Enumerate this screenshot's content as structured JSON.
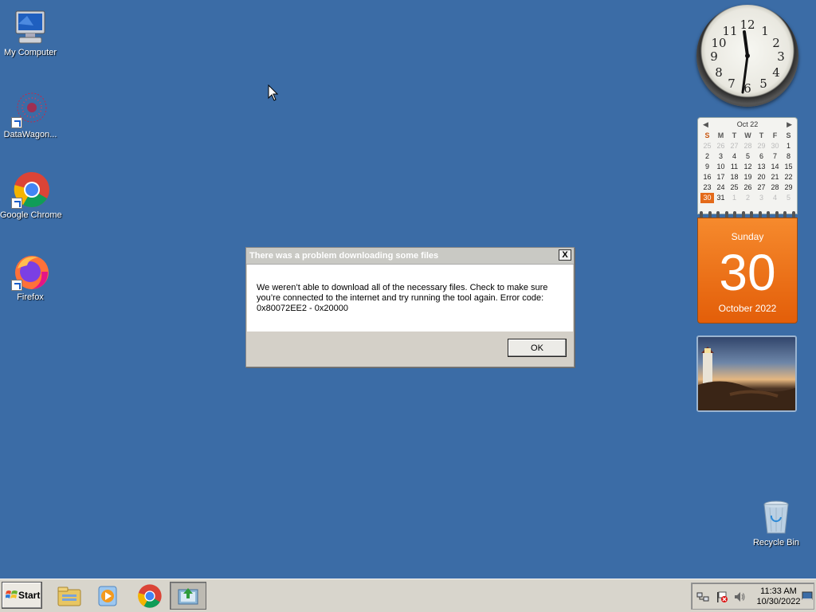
{
  "desktop": {
    "icons": [
      {
        "label": "My Computer",
        "icon": "computer-icon"
      },
      {
        "label": "DataWagon...",
        "icon": "datawagon-icon"
      },
      {
        "label": "Google Chrome",
        "icon": "chrome-icon"
      },
      {
        "label": "Firefox",
        "icon": "firefox-icon"
      },
      {
        "label": "Recycle Bin",
        "icon": "recycle-bin-icon"
      }
    ]
  },
  "clock": {
    "time": "11:33",
    "numbers": [
      "12",
      "1",
      "2",
      "3",
      "4",
      "5",
      "6",
      "7",
      "8",
      "9",
      "10",
      "11"
    ]
  },
  "calendar": {
    "month_label": "Oct 22",
    "weekdays": [
      "S",
      "M",
      "T",
      "W",
      "T",
      "F",
      "S"
    ],
    "weeks": [
      [
        "25",
        "26",
        "27",
        "28",
        "29",
        "30",
        "1"
      ],
      [
        "2",
        "3",
        "4",
        "5",
        "6",
        "7",
        "8"
      ],
      [
        "9",
        "10",
        "11",
        "12",
        "13",
        "14",
        "15"
      ],
      [
        "16",
        "17",
        "18",
        "19",
        "20",
        "21",
        "22"
      ],
      [
        "23",
        "24",
        "25",
        "26",
        "27",
        "28",
        "29"
      ],
      [
        "30",
        "31",
        "1",
        "2",
        "3",
        "4",
        "5"
      ]
    ],
    "day_name": "Sunday",
    "day_number": "30",
    "month_year": "October 2022",
    "today": "30",
    "accent_color": "#e46a1a"
  },
  "dialog": {
    "title": "There was a problem downloading some files",
    "close_label": "X",
    "message": "We weren’t able to download all of the necessary files. Check to make sure you’re connected to the internet and try running the tool again. Error code: 0x80072EE2 - 0x20000",
    "ok_label": "OK"
  },
  "taskbar": {
    "start_label": "Start",
    "pinned": [
      {
        "name": "file-explorer-icon"
      },
      {
        "name": "media-player-icon"
      },
      {
        "name": "chrome-icon"
      },
      {
        "name": "media-creation-tool-icon"
      }
    ],
    "tray": {
      "time": "11:33 AM",
      "date": "10/30/2022"
    }
  },
  "colors": {
    "desktop": "#3b6ca6",
    "taskbar": "#d8d5cc"
  }
}
